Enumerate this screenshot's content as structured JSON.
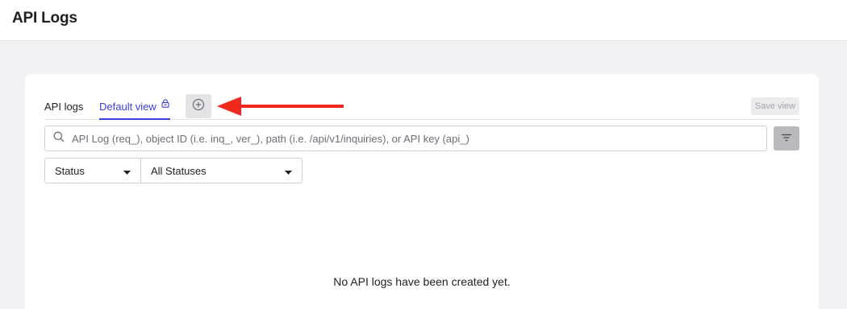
{
  "page": {
    "title": "API Logs"
  },
  "tabs": {
    "static_label": "API logs",
    "active_label": "Default view",
    "active_icon": "lock-icon",
    "add_icon": "plus-circle-icon",
    "save_label": "Save view"
  },
  "search": {
    "placeholder": "API Log (req_), object ID (i.e. inq_, ver_), path (i.e. /api/v1/inquiries), or API key (api_)",
    "value": "",
    "icon": "search-icon",
    "filter_icon": "filter-icon"
  },
  "filter": {
    "field_label": "Status",
    "value_label": "All Statuses"
  },
  "empty_state": {
    "message": "No API logs have been created yet."
  },
  "colors": {
    "accent": "#3b3fd8",
    "annotation_arrow": "#f0281e",
    "page_bg": "#f2f2f4"
  }
}
